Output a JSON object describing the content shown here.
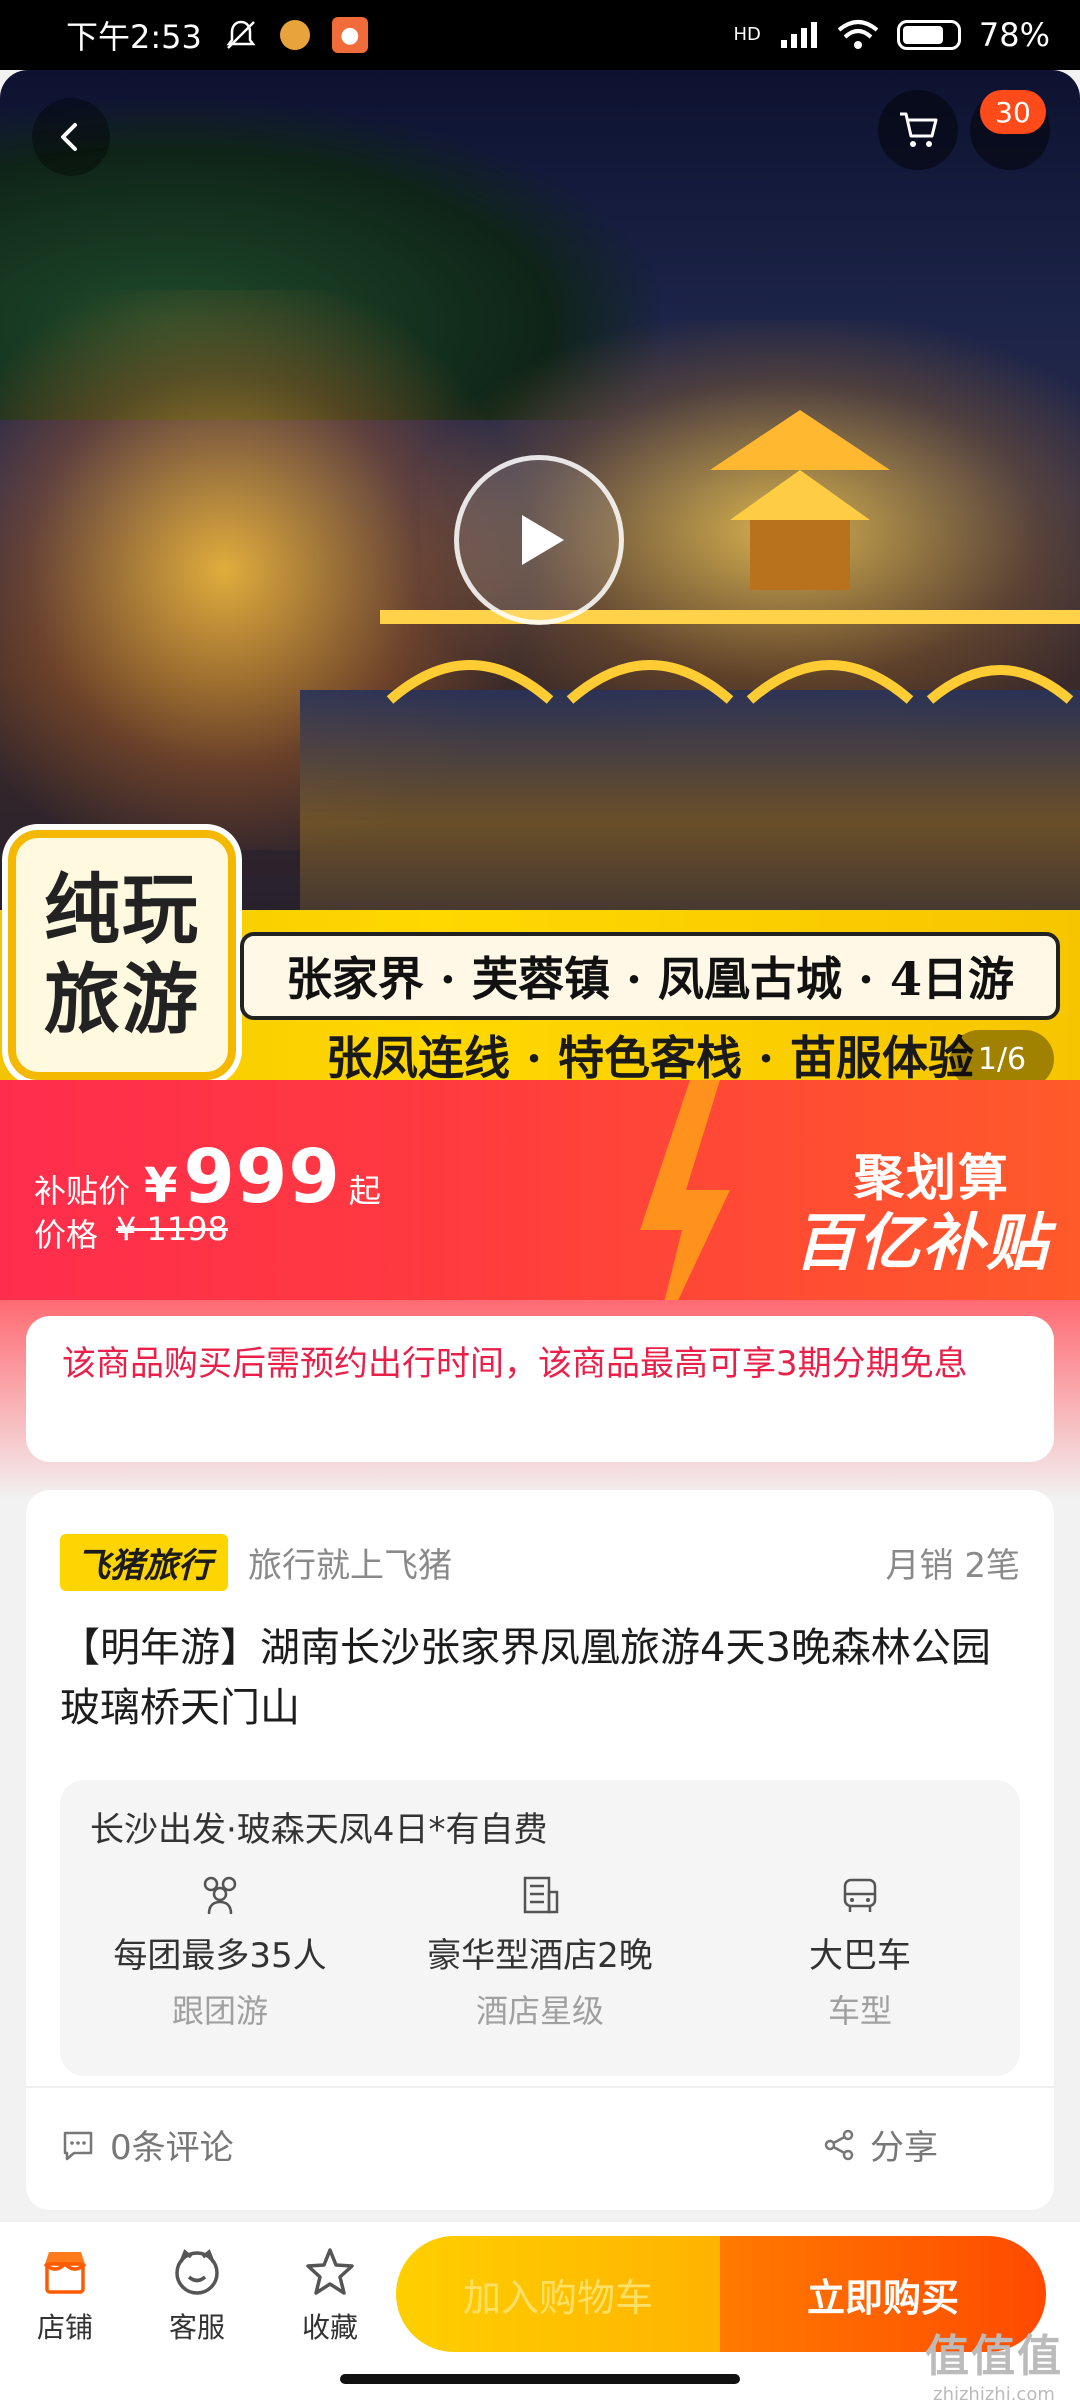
{
  "status_bar": {
    "time": "下午2:53",
    "battery": "78%",
    "battery_level": 0.78,
    "network": "HD"
  },
  "hero": {
    "cart_badge": "30",
    "page_indicator": "1/6",
    "corner_badge": [
      "纯玩",
      "旅游"
    ],
    "route": "张家界 · 芙蓉镇 · 凤凰古城 · 4日游",
    "features": "张凤连线 · 特色客栈 · 苗服体验"
  },
  "price": {
    "subsidy_label": "补贴价",
    "currency": "¥",
    "value": "999",
    "suffix": "起",
    "orig_label": "价格",
    "orig_price": "¥ 1198",
    "promo_line1": "聚划算",
    "promo_line2": "百亿补贴"
  },
  "notice": "该商品购买后需预约出行时间，该商品最高可享3期分期免息",
  "product": {
    "brand": "飞猪旅行",
    "slogan": "旅行就上飞猪",
    "monthly_sales": "月销 2笔",
    "title": "【明年游】湖南长沙张家界凤凰旅游4天3晚森林公园玻璃桥天门山",
    "info_header": "长沙出发·玻森天凤4日*有自费",
    "info_items": [
      {
        "icon": "group-icon",
        "value": "每团最多35人",
        "label": "跟团游"
      },
      {
        "icon": "hotel-icon",
        "value": "豪华型酒店2晚",
        "label": "酒店星级"
      },
      {
        "icon": "bus-icon",
        "value": "大巴车",
        "label": "车型"
      }
    ],
    "reviews": "0条评论",
    "share": "分享"
  },
  "bottom_bar": {
    "shop": "店铺",
    "service": "客服",
    "favorite": "收藏",
    "add_cart": "加入购物车",
    "buy_now": "立即购买"
  },
  "watermark": {
    "text": "值值值",
    "url": "zhizhizhi.com"
  },
  "colors": {
    "accent_red": "#ff2d4d",
    "buy_orange": "#ff5a00",
    "cart_yellow": "#ffc400",
    "notice_red": "#e8204a"
  }
}
